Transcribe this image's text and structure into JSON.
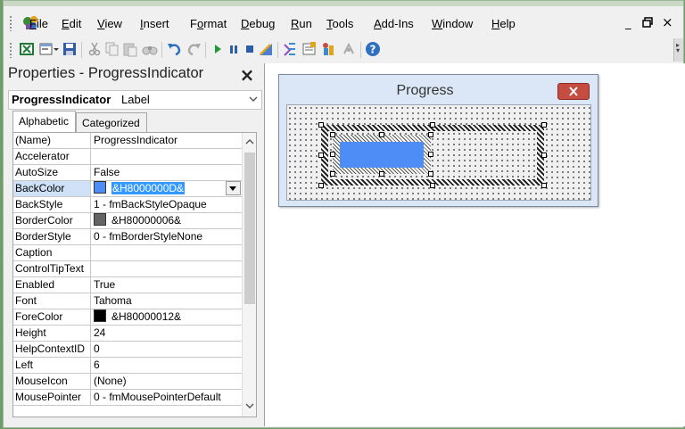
{
  "menubar": {
    "items": [
      {
        "label": "File",
        "u": "F",
        "rest": "ile"
      },
      {
        "label": "Edit",
        "u": "E",
        "rest": "dit"
      },
      {
        "label": "View",
        "u": "V",
        "rest": "iew"
      },
      {
        "label": "Insert",
        "u": "I",
        "rest": "nsert"
      },
      {
        "label": "Format",
        "pre": "F",
        "u": "o",
        "rest": "rmat"
      },
      {
        "label": "Debug",
        "u": "D",
        "rest": "ebug"
      },
      {
        "label": "Run",
        "u": "R",
        "rest": "un"
      },
      {
        "label": "Tools",
        "u": "T",
        "rest": "ools"
      },
      {
        "label": "Add-Ins",
        "u": "A",
        "rest": "dd-Ins"
      },
      {
        "label": "Window",
        "u": "W",
        "rest": "indow"
      },
      {
        "label": "Help",
        "u": "H",
        "rest": "elp"
      }
    ],
    "window_controls": {
      "minimize": "_",
      "restore": "🗗",
      "close": "×"
    }
  },
  "toolbar": {
    "buttons": [
      "excel-icon",
      "insert-userform-icon",
      "save-icon",
      "cut-icon",
      "copy-icon",
      "paste-icon",
      "find-icon",
      "undo-icon",
      "redo-icon",
      "run-icon",
      "break-icon",
      "reset-icon",
      "design-mode-icon",
      "project-explorer-icon",
      "properties-window-icon",
      "object-browser-icon",
      "toolbox-icon",
      "help-icon"
    ]
  },
  "properties": {
    "title": "Properties - ProgressIndicator",
    "close": "×",
    "object_name": "ProgressIndicator",
    "object_type": "Label",
    "tabs": [
      "Alphabetic",
      "Categorized"
    ],
    "rows": [
      {
        "name": "(Name)",
        "value": "ProgressIndicator"
      },
      {
        "name": "Accelerator",
        "value": ""
      },
      {
        "name": "AutoSize",
        "value": "False"
      },
      {
        "name": "BackColor",
        "value": "&H8000000D&",
        "swatch": "#4e8cf6",
        "selected": true
      },
      {
        "name": "BackStyle",
        "value": "1 - fmBackStyleOpaque"
      },
      {
        "name": "BorderColor",
        "value": "&H80000006&",
        "swatch": "#646464"
      },
      {
        "name": "BorderStyle",
        "value": "0 - fmBorderStyleNone"
      },
      {
        "name": "Caption",
        "value": ""
      },
      {
        "name": "ControlTipText",
        "value": ""
      },
      {
        "name": "Enabled",
        "value": "True"
      },
      {
        "name": "Font",
        "value": "Tahoma"
      },
      {
        "name": "ForeColor",
        "value": "&H80000012&",
        "swatch": "#000000"
      },
      {
        "name": "Height",
        "value": "24"
      },
      {
        "name": "HelpContextID",
        "value": "0"
      },
      {
        "name": "Left",
        "value": "6"
      },
      {
        "name": "MouseIcon",
        "value": "(None)"
      },
      {
        "name": "MousePointer",
        "value": "0 - fmMousePointerDefault"
      }
    ]
  },
  "userform": {
    "title": "Progress"
  },
  "colors": {
    "accent": "#4e8cf6",
    "close_button": "#c44c40",
    "selection": "#3399ff"
  }
}
